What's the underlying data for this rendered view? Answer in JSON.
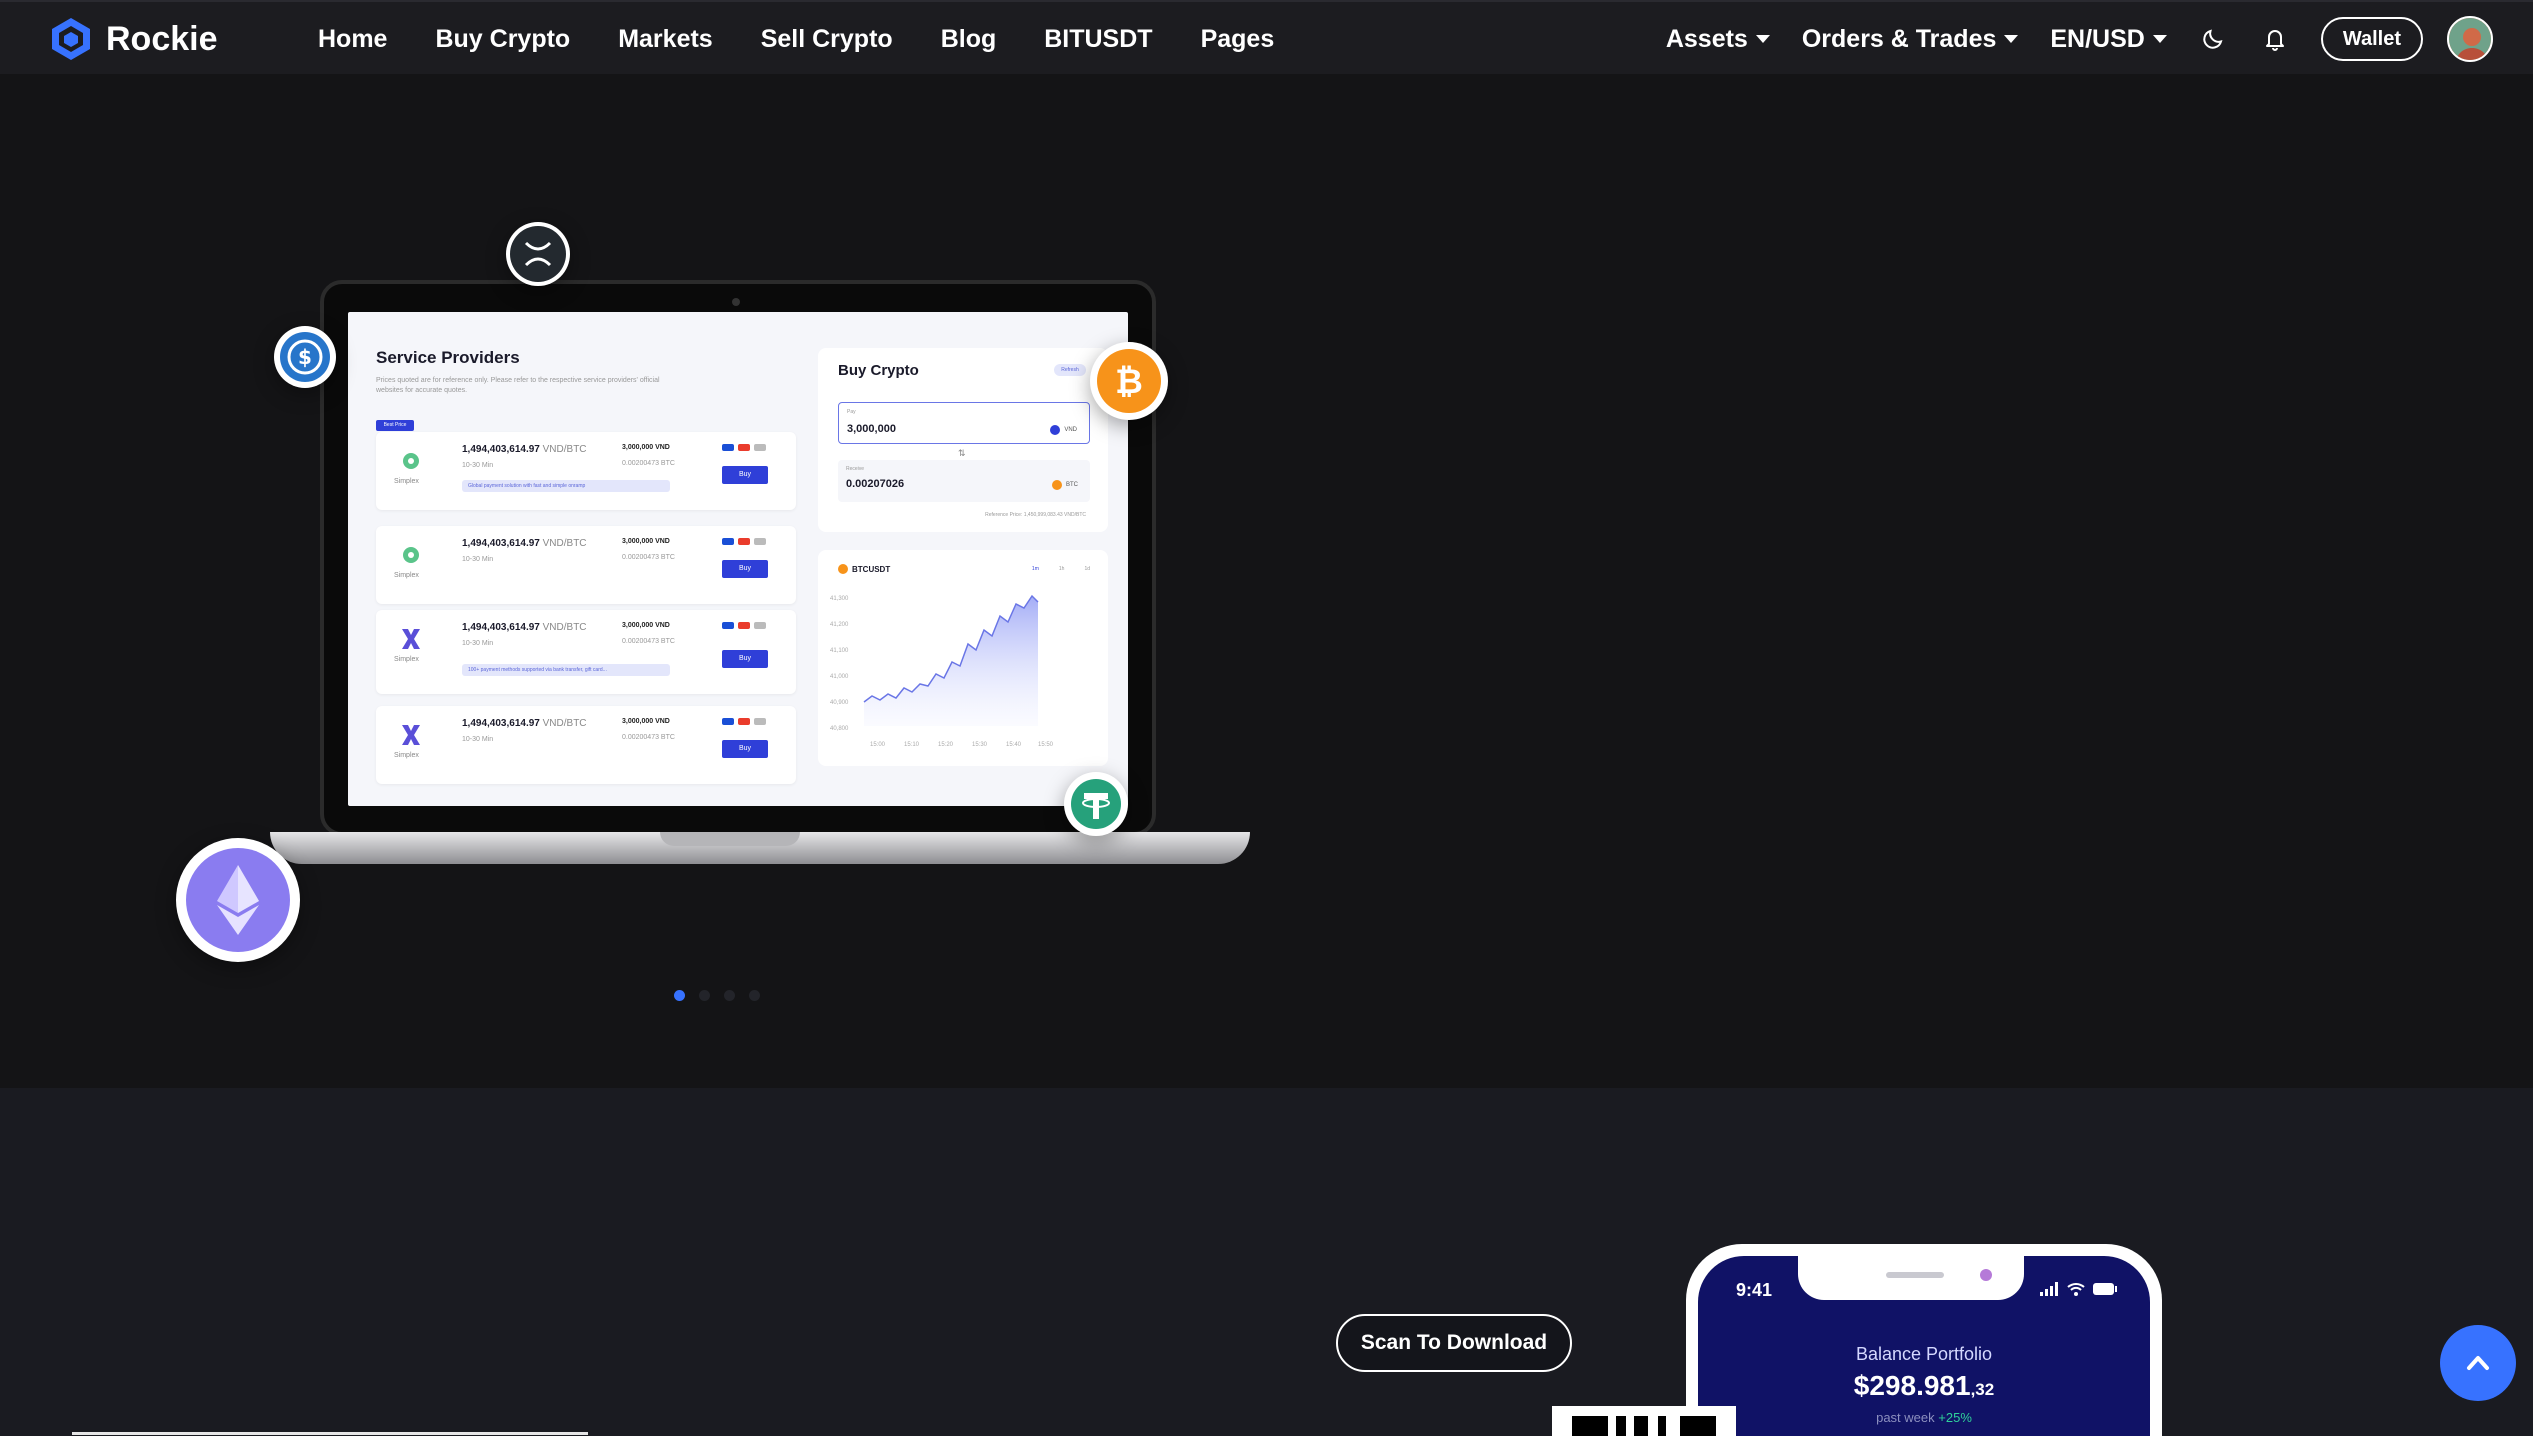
{
  "brand": {
    "name": "Rockie",
    "accent": "#3772ff"
  },
  "nav": {
    "items": [
      "Home",
      "Buy Crypto",
      "Markets",
      "Sell Crypto",
      "Blog",
      "BITUSDT",
      "Pages"
    ],
    "dropdowns": [
      "Assets",
      "Orders & Trades",
      "EN/USD"
    ],
    "theme_icon": "moon-icon",
    "notification_icon": "bell-icon",
    "wallet_label": "Wallet"
  },
  "hero_slider": {
    "active_slide": 1,
    "slide_count": 4,
    "screen": {
      "service_providers": {
        "title": "Service Providers",
        "description": "Prices quoted are for reference only. Please refer to the respective service providers' official websites for accurate quotes.",
        "best_tag": "Best Price",
        "rows": [
          {
            "provider": "Simplex",
            "price": "1,494,403,614.97",
            "unit": "VND/BTC",
            "time": "10-30 Min",
            "amount": "3,000,000 VND",
            "crypto": "0.00200473 BTC",
            "buy": "Buy",
            "note": "Global payment solution with fast and simple onramp"
          },
          {
            "provider": "Simplex",
            "price": "1,494,403,614.97",
            "unit": "VND/BTC",
            "time": "10-30 Min",
            "amount": "3,000,000 VND",
            "crypto": "0.00200473 BTC",
            "buy": "Buy",
            "note": ""
          },
          {
            "provider": "Simplex",
            "price": "1,494,403,614.97",
            "unit": "VND/BTC",
            "time": "10-30 Min",
            "amount": "3,000,000 VND",
            "crypto": "0.00200473 BTC",
            "buy": "Buy",
            "note": "100+ payment methods supported via bank transfer, gift card..."
          },
          {
            "provider": "Simplex",
            "price": "1,494,403,614.97",
            "unit": "VND/BTC",
            "time": "10-30 Min",
            "amount": "3,000,000 VND",
            "crypto": "0.00200473 BTC",
            "buy": "Buy",
            "note": ""
          }
        ]
      },
      "buy_crypto": {
        "title": "Buy Crypto",
        "badge": "Refresh",
        "pay_label": "Pay",
        "pay_value": "3,000,000",
        "pay_currency": "VND",
        "receive_label": "Receive",
        "receive_value": "0.00207026",
        "receive_currency": "BTC",
        "reference": "Reference Price: 1,450,999,083.43 VND/BTC"
      },
      "chart_card": {
        "symbol": "BTCUSDT",
        "tabs": [
          "1m",
          "1h",
          "1d"
        ],
        "y_ticks": [
          "41,300",
          "41,200",
          "41,100",
          "41,000",
          "40,900",
          "40,800"
        ],
        "x_ticks": [
          "15:00",
          "15:10",
          "15:20",
          "15:30",
          "15:40",
          "15:50"
        ]
      }
    },
    "coins": [
      "xrp-icon",
      "usdc-icon",
      "bitcoin-icon",
      "ethereum-icon",
      "tether-icon"
    ]
  },
  "download": {
    "scan_label": "Scan To Download",
    "phone": {
      "time": "9:41",
      "balance_label": "Balance Portfolio",
      "balance_value": "$298.981",
      "balance_cents": ",32",
      "week_label": "past week",
      "week_change": "+25%"
    }
  },
  "scroll_top_icon": "chevron-up-icon",
  "colors": {
    "page_bg": "#141416",
    "navbar_bg": "#1c1c20",
    "section2_bg": "#1a1b21",
    "bitcoin": "#f7931a",
    "tether": "#26a17b",
    "ethereum": "#8a7cf0",
    "usdc": "#2775ca"
  }
}
